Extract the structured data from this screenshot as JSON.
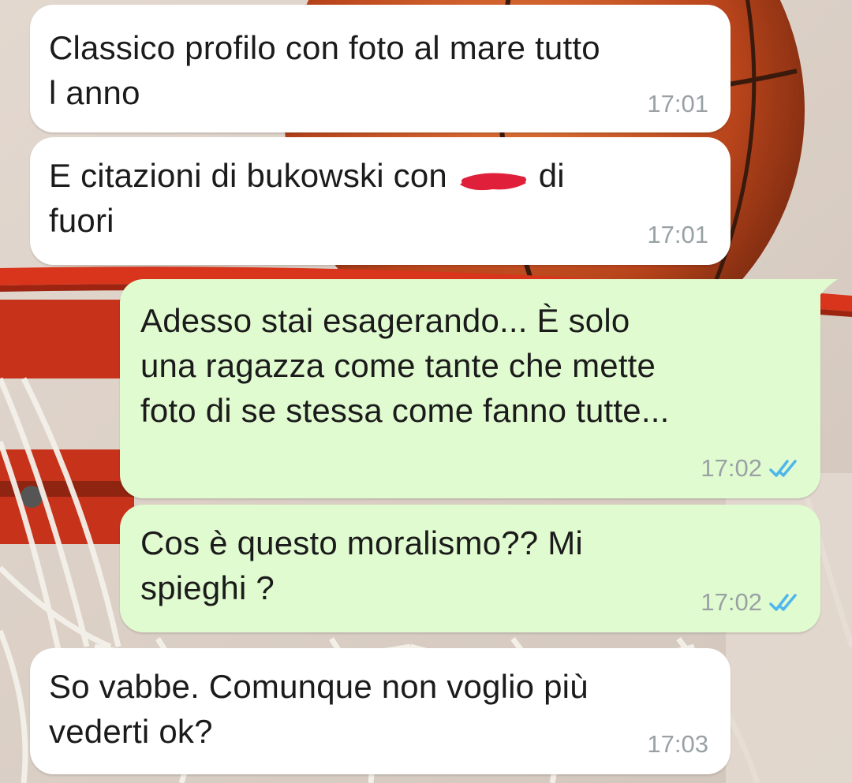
{
  "conversation": {
    "messages": [
      {
        "direction": "incoming",
        "text": "Classico profilo con foto al mare tutto\nl anno",
        "time": "17:01"
      },
      {
        "direction": "incoming",
        "text_before_redaction": "E citazioni di bukowski con ",
        "text_after_redaction": " di\nfuori",
        "time": "17:01"
      },
      {
        "direction": "outgoing",
        "text": "Adesso stai esagerando... È solo\nuna ragazza come tante che mette\nfoto di se stessa come fanno tutte...",
        "time": "17:02",
        "status_icon": "double-check-read-icon"
      },
      {
        "direction": "outgoing",
        "text": "Cos è questo moralismo?? Mi\nspieghi ?",
        "time": "17:02",
        "status_icon": "double-check-read-icon"
      },
      {
        "direction": "incoming",
        "text": "So vabbe. Comunque non voglio più\nvederti ok?",
        "time": "17:03"
      }
    ]
  },
  "colors": {
    "incoming_bubble": "#ffffff",
    "outgoing_bubble": "#e1fbd0",
    "read_ticks": "#4fb6ec",
    "timestamp": "#9aa1a5",
    "redaction": "#e0203a"
  }
}
